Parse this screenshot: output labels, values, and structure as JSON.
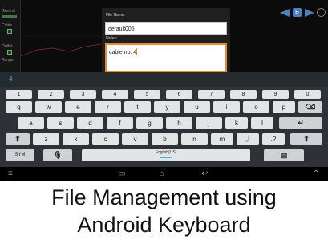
{
  "app": {
    "left_strip_labels": [
      "Ground",
      "Cable",
      "Outlet",
      "Range"
    ],
    "tool_box_label": "B"
  },
  "dialog": {
    "filename_label": "File Name:",
    "filename_value": "default005",
    "notes_label": "Notes:",
    "notes_value": "cable no. 4"
  },
  "suggestion": {
    "word": "4"
  },
  "keyboard": {
    "row1": [
      "1",
      "2",
      "3",
      "4",
      "5",
      "6",
      "7",
      "8",
      "9",
      "0"
    ],
    "row2": [
      "q",
      "w",
      "e",
      "r",
      "t",
      "y",
      "u",
      "i",
      "o",
      "p"
    ],
    "row3": [
      "a",
      "s",
      "d",
      "f",
      "g",
      "h",
      "j",
      "k",
      "l"
    ],
    "row4": [
      "z",
      "x",
      "c",
      "v",
      "b",
      "n",
      "m",
      ",!",
      ".?"
    ],
    "sym_label": "SYM",
    "space_label": "English(US)",
    "icons": {
      "backspace": "backspace-icon",
      "enter": "enter-icon",
      "shift": "shift-icon",
      "mic": "mic-icon",
      "settings": "clipboard-icon"
    }
  },
  "navbar": {
    "icons": [
      "menu-icon",
      "recents-icon",
      "home-icon",
      "back-icon",
      "hide-keyboard-icon"
    ]
  },
  "caption": {
    "line1": "File Management using",
    "line2": "Android Keyboard"
  }
}
